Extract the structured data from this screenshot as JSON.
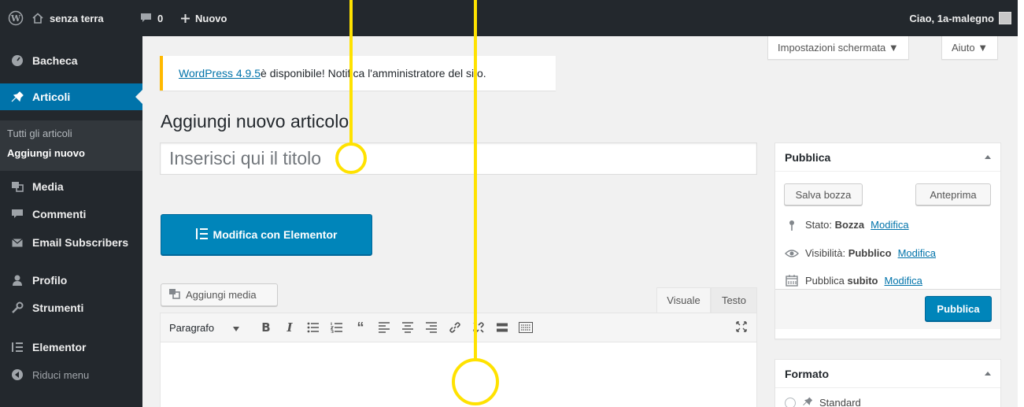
{
  "adminbar": {
    "site_name": "senza terra",
    "comments_count": "0",
    "new_label": "Nuovo",
    "greeting": "Ciao, 1a-malegno"
  },
  "sidebar": {
    "items": [
      {
        "label": "Bacheca",
        "icon": "dashboard-icon"
      },
      {
        "label": "Articoli",
        "icon": "pin-icon",
        "active": true
      },
      {
        "label": "Media",
        "icon": "media-icon"
      },
      {
        "label": "Commenti",
        "icon": "comment-icon"
      },
      {
        "label": "Email Subscribers",
        "icon": "email-icon"
      },
      {
        "label": "Profilo",
        "icon": "user-icon"
      },
      {
        "label": "Strumenti",
        "icon": "wrench-icon"
      },
      {
        "label": "Elementor",
        "icon": "elementor-icon"
      }
    ],
    "submenu": [
      "Tutti gli articoli",
      "Aggiungi nuovo"
    ],
    "collapse_label": "Riduci menu"
  },
  "screen_options": {
    "settings_label": "Impostazioni schermata ▼",
    "help_label": "Aiuto ▼"
  },
  "notice": {
    "link_text": "WordPress 4.9.5",
    "text": " è disponibile! Notifica l'amministratore del sito."
  },
  "page_title": "Aggiungi nuovo articolo",
  "title_input": {
    "placeholder": "Inserisci qui il titolo",
    "value": ""
  },
  "elementor_button": "Modifica con Elementor",
  "add_media_button": "Aggiungi media",
  "editor": {
    "tabs": [
      "Visuale",
      "Testo"
    ],
    "format_select": "Paragrafo",
    "toolbar_icons": [
      "bold-icon",
      "italic-icon",
      "bullet-list-icon",
      "numbered-list-icon",
      "blockquote-icon",
      "align-left-icon",
      "align-center-icon",
      "align-right-icon",
      "link-icon",
      "unlink-icon",
      "read-more-icon",
      "toolbar-toggle-icon",
      "fullscreen-icon"
    ]
  },
  "publish_box": {
    "title": "Pubblica",
    "save_draft": "Salva bozza",
    "preview": "Anteprima",
    "status_label": "Stato:",
    "status_value": "Bozza",
    "visibility_label": "Visibilità:",
    "visibility_value": "Pubblico",
    "schedule_label": "Pubblica",
    "schedule_value": "subito",
    "edit_link": "Modifica",
    "publish_button": "Pubblica"
  },
  "format_box": {
    "title": "Formato",
    "first_option": "Standard"
  },
  "colors": {
    "admin_dark": "#23282d",
    "accent_blue": "#0073aa",
    "primary_button": "#0085ba",
    "notice_yellow": "#ffb900",
    "annotation_yellow": "#ffe200"
  }
}
